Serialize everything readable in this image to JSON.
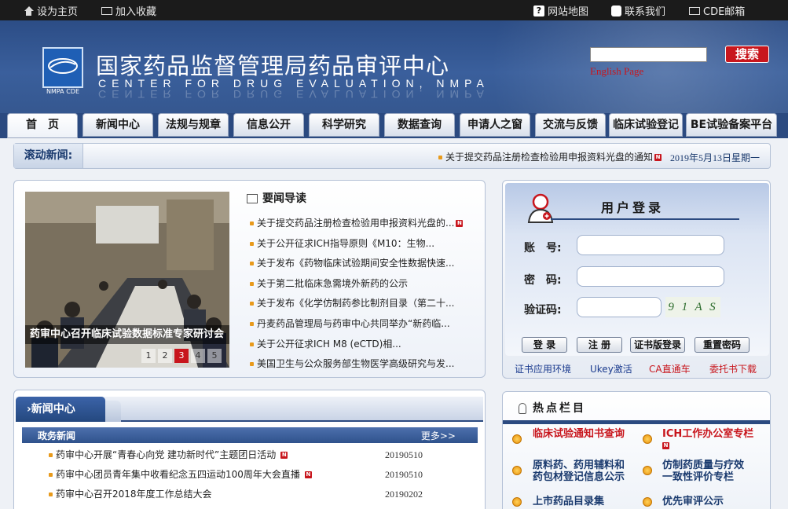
{
  "topbar": {
    "set_home": "设为主页",
    "add_favorite": "加入收藏",
    "site_map": "网站地图",
    "contact": "联系我们",
    "cde_mail": "CDE邮箱"
  },
  "header": {
    "title_cn": "国家药品监督管理局药品审评中心",
    "title_en": "CENTER FOR DRUG EVALUATION, NMPA",
    "logo_text": "NMPA CDE",
    "search_button": "搜索",
    "english_link": "English Page"
  },
  "nav": {
    "tabs": [
      "首　页",
      "新闻中心",
      "法规与规章",
      "信息公开",
      "科学研究",
      "数据查询",
      "申请人之窗",
      "交流与反馈",
      "临床试验登记",
      "BE试验备案平台"
    ]
  },
  "ticker": {
    "label": "滚动新闻:",
    "text": "关于提交药品注册检查检验用申报资料光盘的通知",
    "date": "2019年5月13日星期一"
  },
  "news": {
    "photo_caption": "药审中心召开临床试验数据标准专家研讨会",
    "photo_pages": [
      "1",
      "2",
      "3",
      "4",
      "5"
    ],
    "active_page": "3",
    "section_title": "要闻导读",
    "items": [
      {
        "text": "关于提交药品注册检查检验用申报资料光盘的...",
        "new": "N"
      },
      {
        "text": "关于公开征求ICH指导原则《M10：生物...",
        "new": ""
      },
      {
        "text": "关于发布《药物临床试验期间安全性数据快速...",
        "new": ""
      },
      {
        "text": "关于第二批临床急需境外新药的公示",
        "new": ""
      },
      {
        "text": "关于发布《化学仿制药参比制剂目录（第二十...",
        "new": ""
      },
      {
        "text": "丹麦药品管理局与药审中心共同举办“新药临...",
        "new": ""
      },
      {
        "text": "关于公开征求ICH M8 (eCTD)相...",
        "new": ""
      },
      {
        "text": "美国卫生与公众服务部生物医学高级研究与发...",
        "new": ""
      }
    ]
  },
  "login": {
    "title": "用户登录",
    "account_label": "账　号:",
    "password_label": "密　码:",
    "captcha_label": "验证码:",
    "captcha_value": "9 1 A S",
    "buttons": [
      "登 录",
      "注 册",
      "证书版登录",
      "重置密码"
    ],
    "links": [
      {
        "text": "证书应用环境",
        "color": "#1a3a8e"
      },
      {
        "text": "Ukey激活",
        "color": "#1a3a8e"
      },
      {
        "text": "CA直通车",
        "color": "#c8161d"
      },
      {
        "text": "委托书下载",
        "color": "#c8161d"
      }
    ]
  },
  "center": {
    "tab": "新闻中心",
    "sub_title": "政务新闻",
    "more": "更多>>",
    "items": [
      {
        "text": "药审中心开展“青春心向党 建功新时代”主题团日活动",
        "new": "N",
        "date": "20190510"
      },
      {
        "text": "药审中心团员青年集中收看纪念五四运动100周年大会直播",
        "new": "N",
        "date": "20190510"
      },
      {
        "text": "药审中心召开2018年度工作总结大会",
        "new": "",
        "date": "20190202"
      }
    ]
  },
  "hot": {
    "title": "热点栏目",
    "items": [
      {
        "text": "临床试验通知书查询",
        "color": "#c8161d"
      },
      {
        "text": "ICH工作办公室专栏",
        "color": "#c8161d"
      },
      {
        "text": "原料药、药用辅料和药包材登记信息公示",
        "color": "#1a3a6e"
      },
      {
        "text": "仿制药质量与疗效一致性评价专栏",
        "color": "#1a3a6e"
      },
      {
        "text": "上市药品目录集",
        "color": "#1a3a6e"
      },
      {
        "text": "优先审评公示",
        "color": "#1a3a6e"
      }
    ],
    "new_badge": "N"
  },
  "colors": {
    "brand_blue": "#2b4a80",
    "accent_red": "#c8161d",
    "bullet_orange": "#e89a1c"
  }
}
